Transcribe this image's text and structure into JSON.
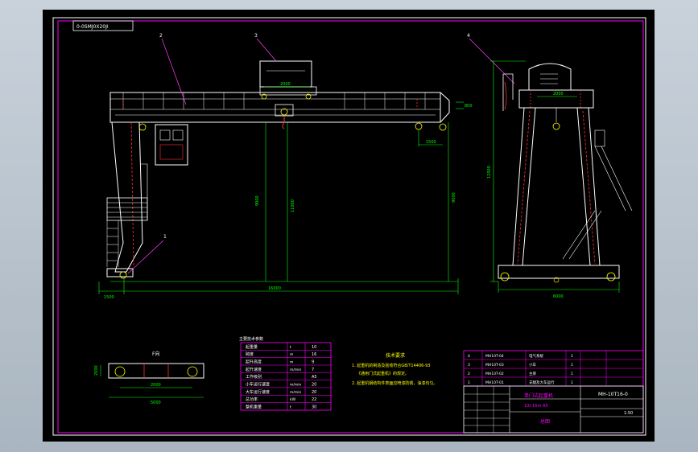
{
  "title_tag": "0-0SMJ0X20JI",
  "part_labels": [
    "1",
    "2",
    "3",
    "4"
  ],
  "front_view": {
    "dim_trolley_gauge": "2000",
    "dim_left_overhang": "1500",
    "dim_right_overhang": "1500",
    "dim_span": "16000",
    "dim_left_end": "1500",
    "dim_height_a": "9000",
    "dim_height_b": "11000",
    "dim_height_c": "9000",
    "dim_small_right": "800"
  },
  "side_view": {
    "dim_top": "2000",
    "dim_total_height": "12000",
    "dim_base": "6000"
  },
  "plan_view": {
    "label": "F向",
    "dim_inner": "2000",
    "dim_outer": "5000",
    "dim_left": "2000"
  },
  "tech_table": {
    "caption": "主要技术参数",
    "rows": [
      [
        "起重量",
        "t",
        "10"
      ],
      [
        "跨度",
        "m",
        "16"
      ],
      [
        "起升高度",
        "m",
        "9"
      ],
      [
        "起升速度",
        "m/min",
        "7"
      ],
      [
        "工作级别",
        "",
        "A5"
      ],
      [
        "小车运行速度",
        "m/min",
        "20"
      ],
      [
        "大车运行速度",
        "m/min",
        "20"
      ],
      [
        "总功率",
        "kW",
        "22"
      ],
      [
        "整机重量",
        "t",
        "30"
      ]
    ]
  },
  "notes": {
    "heading": "技术要求",
    "lines": [
      "1. 起重机的制造及验收符合GB/T14406-93",
      "《通用门式起重机》的规定。",
      "2. 起重机钢结构件表面应喷漆防锈，油漆均匀。"
    ]
  },
  "title_block": {
    "drawing_no": "MH-10T16-0",
    "title_line1": "单门式起重机",
    "title_line2": "10t-16m  A5",
    "sheet_name": "总图",
    "scale": "1:50",
    "bom_rows": [
      [
        "4",
        "MH10T-04",
        "电气系统",
        "1",
        "",
        ""
      ],
      [
        "3",
        "MH10T-03",
        "小车",
        "1",
        "",
        ""
      ],
      [
        "2",
        "MH10T-02",
        "主梁",
        "1",
        "",
        ""
      ],
      [
        "1",
        "MH10T-01",
        "支腿及大车运行",
        "1",
        "",
        ""
      ]
    ]
  },
  "colors": {
    "structure": "#ffffff",
    "dimension": "#00ff00",
    "leader": "#ff40ff",
    "frame": "#ff00ff",
    "text": "#ffff00",
    "hook": "#ffff00",
    "red": "#ff3030",
    "table": "#ff00ff"
  }
}
